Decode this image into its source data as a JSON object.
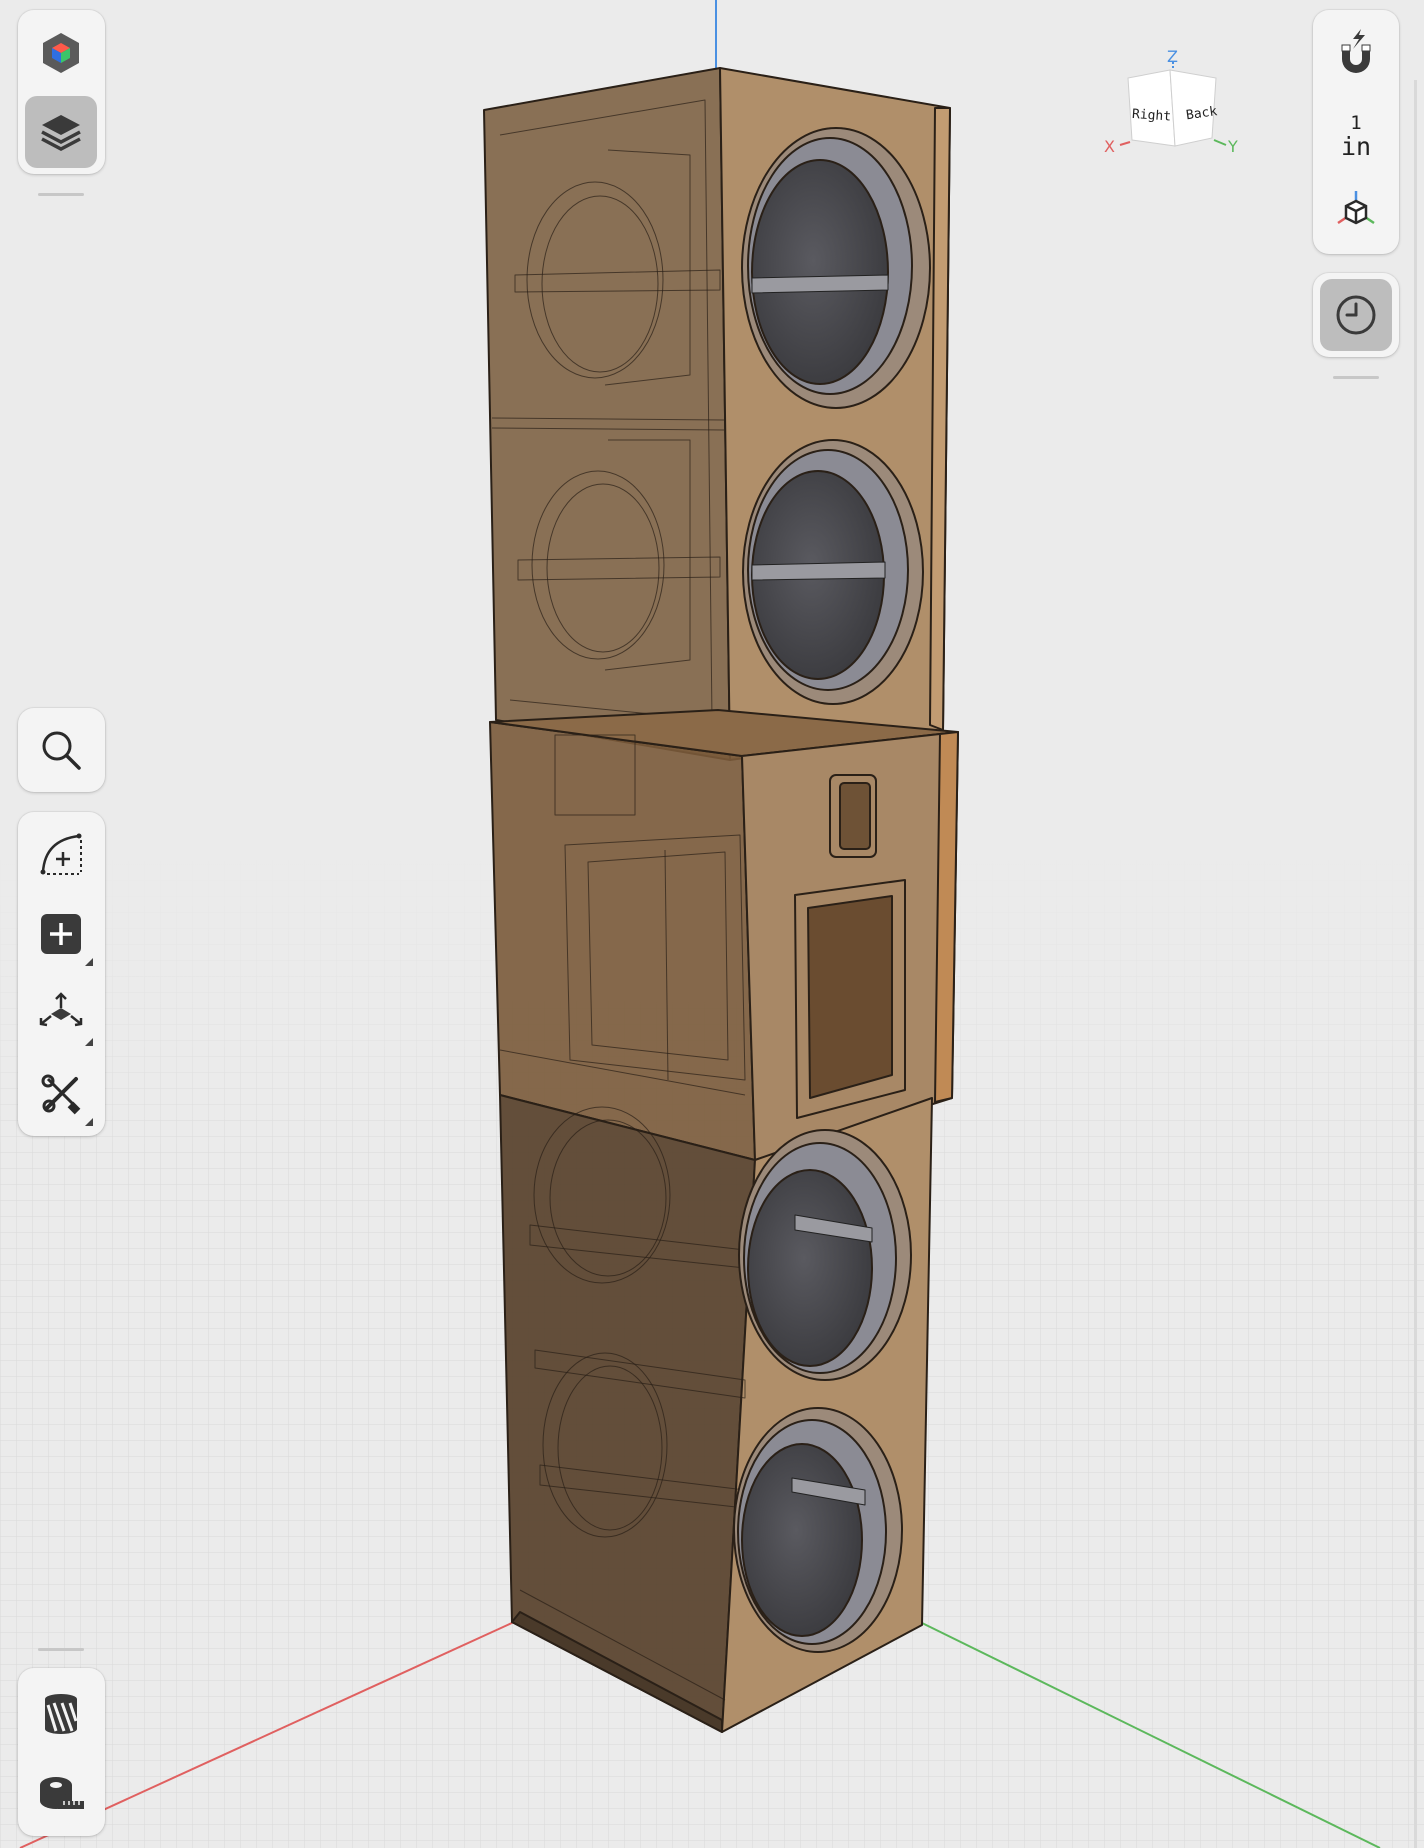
{
  "viewcube": {
    "faces": {
      "right": "Right",
      "back": "Back"
    },
    "axes": {
      "x": "X",
      "y": "Y",
      "z": "Z"
    }
  },
  "units": {
    "value": "1",
    "unit": "in"
  },
  "left_toolbar": {
    "top": [
      "app-logo",
      "layers"
    ],
    "middle": [
      "search"
    ],
    "tools": [
      "sketch",
      "add-primitive",
      "transform",
      "modify-tools"
    ],
    "bottom": [
      "materials",
      "measure"
    ]
  },
  "right_toolbar": [
    "snapping",
    "units",
    "view-orientation",
    "history"
  ],
  "colors": {
    "background": "#ebebeb",
    "grid": "#dcdcdc",
    "x_axis": "#e06060",
    "y_axis": "#5cb85c",
    "z_axis": "#4a90e2",
    "wood_face": "#8a6a47",
    "wood_side": "#b08f6a",
    "driver": "#4b4b50"
  }
}
